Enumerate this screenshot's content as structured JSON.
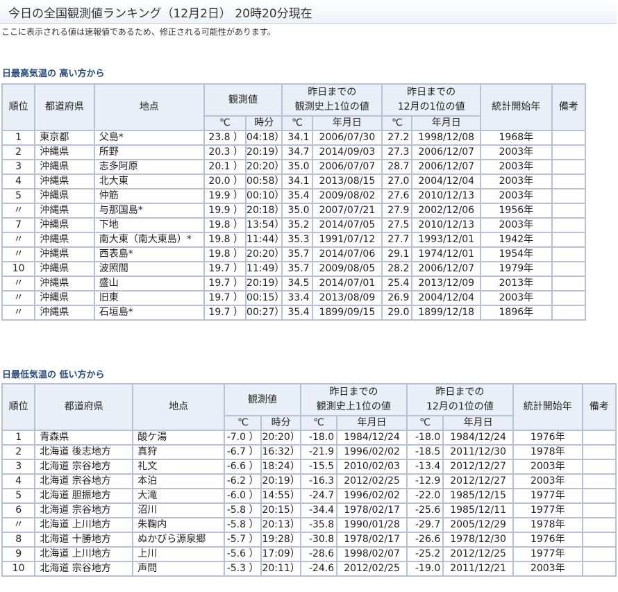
{
  "page": {
    "title": "今日の全国観測値ランキング（12月2日） 20時20分現在",
    "note": "ここに表示される値は速報値であるため、修正される可能性があります。"
  },
  "high": {
    "section_title": "日最高気温の 高い方から",
    "headers": {
      "rank": "順位",
      "pref": "都道府県",
      "point": "地点",
      "obs": "観測値",
      "hist": "昨日までの\n観測史上1位の値",
      "month": "昨日までの\n12月の1位の値",
      "start": "統計開始年",
      "remarks": "備考",
      "deg": "℃",
      "time": "時分",
      "date": "年月日"
    },
    "rows": [
      {
        "rank": "1",
        "pref": "東京都",
        "point": "父島*",
        "val": "23.8 ）",
        "time": "04:18）",
        "hv": "34.1",
        "hd": "2006/07/30",
        "mv": "27.2",
        "md": "1998/12/08",
        "start": "1968年",
        "rem": ""
      },
      {
        "rank": "2",
        "pref": "沖縄県",
        "point": "所野",
        "val": "20.3 ）",
        "time": "20:19）",
        "hv": "34.7",
        "hd": "2014/09/03",
        "mv": "27.3",
        "md": "2006/12/07",
        "start": "2003年",
        "rem": ""
      },
      {
        "rank": "3",
        "pref": "沖縄県",
        "point": "志多阿原",
        "val": "20.1 ）",
        "time": "20:20）",
        "hv": "35.0",
        "hd": "2006/07/07",
        "mv": "28.7",
        "md": "2006/12/07",
        "start": "2003年",
        "rem": ""
      },
      {
        "rank": "4",
        "pref": "沖縄県",
        "point": "北大東",
        "val": "20.0 ）",
        "time": "00:58）",
        "hv": "34.1",
        "hd": "2013/08/15",
        "mv": "27.0",
        "md": "2004/12/04",
        "start": "2003年",
        "rem": ""
      },
      {
        "rank": "5",
        "pref": "沖縄県",
        "point": "仲筋",
        "val": "19.9 ）",
        "time": "00:10）",
        "hv": "35.4",
        "hd": "2009/08/02",
        "mv": "27.6",
        "md": "2010/12/13",
        "start": "2003年",
        "rem": ""
      },
      {
        "rank": "〃",
        "pref": "沖縄県",
        "point": "与那国島*",
        "val": "19.9 ）",
        "time": "20:18）",
        "hv": "35.0",
        "hd": "2007/07/21",
        "mv": "27.9",
        "md": "2002/12/06",
        "start": "1956年",
        "rem": ""
      },
      {
        "rank": "7",
        "pref": "沖縄県",
        "point": "下地",
        "val": "19.8 ）",
        "time": "13:54）",
        "hv": "35.2",
        "hd": "2014/07/05",
        "mv": "27.5",
        "md": "2010/12/13",
        "start": "2003年",
        "rem": ""
      },
      {
        "rank": "〃",
        "pref": "沖縄県",
        "point": "南大東（南大東島）*",
        "val": "19.8 ）",
        "time": "11:44）",
        "hv": "35.3",
        "hd": "1991/07/12",
        "mv": "27.7",
        "md": "1993/12/01",
        "start": "1942年",
        "rem": ""
      },
      {
        "rank": "〃",
        "pref": "沖縄県",
        "point": "西表島*",
        "val": "19.8 ）",
        "time": "20:20）",
        "hv": "35.7",
        "hd": "2014/07/06",
        "mv": "29.1",
        "md": "1974/12/01",
        "start": "1954年",
        "rem": ""
      },
      {
        "rank": "10",
        "pref": "沖縄県",
        "point": "波照間",
        "val": "19.7 ）",
        "time": "11:49）",
        "hv": "35.7",
        "hd": "2009/08/05",
        "mv": "28.2",
        "md": "2006/12/07",
        "start": "1979年",
        "rem": ""
      },
      {
        "rank": "〃",
        "pref": "沖縄県",
        "point": "盛山",
        "val": "19.7 ）",
        "time": "20:19）",
        "hv": "34.5",
        "hd": "2014/07/01",
        "mv": "25.4",
        "md": "2013/12/09",
        "start": "2013年",
        "rem": ""
      },
      {
        "rank": "〃",
        "pref": "沖縄県",
        "point": "旧東",
        "val": "19.7 ）",
        "time": "00:15）",
        "hv": "33.4",
        "hd": "2013/08/09",
        "mv": "26.9",
        "md": "2004/12/04",
        "start": "2003年",
        "rem": ""
      },
      {
        "rank": "〃",
        "pref": "沖縄県",
        "point": "石垣島*",
        "val": "19.7 ）",
        "time": "00:27）",
        "hv": "35.4",
        "hd": "1899/09/15",
        "mv": "29.0",
        "md": "1899/12/18",
        "start": "1896年",
        "rem": ""
      }
    ]
  },
  "low": {
    "section_title": "日最低気温の 低い方から",
    "headers": {
      "rank": "順位",
      "pref": "都道府県",
      "point": "地点",
      "obs": "観測値",
      "hist": "昨日までの\n観測史上1位の値",
      "month": "昨日までの\n12月の1位の値",
      "start": "統計開始年",
      "remarks": "備考",
      "deg": "℃",
      "time": "時分",
      "date": "年月日"
    },
    "rows": [
      {
        "rank": "1",
        "pref": "青森県",
        "point": "酸ケ湯",
        "val": "-7.0 ）",
        "time": "20:20）",
        "hv": "-18.0",
        "hd": "1984/12/24",
        "mv": "-18.0",
        "md": "1984/12/24",
        "start": "1976年",
        "rem": ""
      },
      {
        "rank": "2",
        "pref": "北海道 後志地方",
        "point": "真狩",
        "val": "-6.7 ）",
        "time": "16:32）",
        "hv": "-21.9",
        "hd": "1996/02/02",
        "mv": "-18.5",
        "md": "2011/12/30",
        "start": "1978年",
        "rem": ""
      },
      {
        "rank": "3",
        "pref": "北海道 宗谷地方",
        "point": "礼文",
        "val": "-6.6 ）",
        "time": "18:24）",
        "hv": "-15.5",
        "hd": "2010/02/03",
        "mv": "-13.4",
        "md": "2012/12/27",
        "start": "2003年",
        "rem": ""
      },
      {
        "rank": "4",
        "pref": "北海道 宗谷地方",
        "point": "本泊",
        "val": "-6.2 ）",
        "time": "20:19）",
        "hv": "-16.3",
        "hd": "2012/02/25",
        "mv": "-12.9",
        "md": "2012/12/27",
        "start": "2003年",
        "rem": ""
      },
      {
        "rank": "5",
        "pref": "北海道 胆振地方",
        "point": "大滝",
        "val": "-6.0 ）",
        "time": "14:55）",
        "hv": "-24.7",
        "hd": "1996/02/02",
        "mv": "-22.0",
        "md": "1985/12/15",
        "start": "1977年",
        "rem": ""
      },
      {
        "rank": "6",
        "pref": "北海道 宗谷地方",
        "point": "沼川",
        "val": "-5.8 ）",
        "time": "20:15）",
        "hv": "-34.4",
        "hd": "1978/02/17",
        "mv": "-25.6",
        "md": "1985/12/11",
        "start": "1977年",
        "rem": ""
      },
      {
        "rank": "〃",
        "pref": "北海道 上川地方",
        "point": "朱鞠内",
        "val": "-5.8 ）",
        "time": "20:13）",
        "hv": "-35.8",
        "hd": "1990/01/28",
        "mv": "-29.7",
        "md": "2005/12/29",
        "start": "1978年",
        "rem": ""
      },
      {
        "rank": "8",
        "pref": "北海道 十勝地方",
        "point": "ぬかびら源泉郷",
        "val": "-5.7 ）",
        "time": "19:28）",
        "hv": "-30.8",
        "hd": "1978/02/17",
        "mv": "-26.6",
        "md": "1978/12/30",
        "start": "1976年",
        "rem": ""
      },
      {
        "rank": "9",
        "pref": "北海道 上川地方",
        "point": "上川",
        "val": "-5.6 ）",
        "time": "17:09）",
        "hv": "-28.6",
        "hd": "1998/02/07",
        "mv": "-25.2",
        "md": "2012/12/25",
        "start": "1977年",
        "rem": ""
      },
      {
        "rank": "10",
        "pref": "北海道 宗谷地方",
        "point": "声問",
        "val": "-5.3 ）",
        "time": "20:11）",
        "hv": "-24.6",
        "hd": "2012/02/25",
        "mv": "-19.0",
        "md": "2011/12/21",
        "start": "2003年",
        "rem": ""
      }
    ]
  }
}
